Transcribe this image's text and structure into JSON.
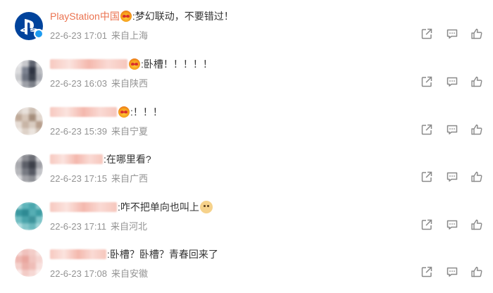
{
  "comments": [
    {
      "user": "PlayStation中国",
      "text": ":梦幻联动，不要错过！",
      "date": "22-6-23 17:01",
      "location": "来自上海",
      "verified": true
    },
    {
      "user": "",
      "text": ":卧槽！！！！！",
      "date": "22-6-23 16:03",
      "location": "来自陕西"
    },
    {
      "user": "",
      "text": ":！！！",
      "date": "22-6-23 15:39",
      "location": "来自宁夏"
    },
    {
      "user": "",
      "text": ":在哪里看?",
      "date": "22-6-23 17:15",
      "location": "来自广西"
    },
    {
      "user": "",
      "text": ":咋不把单向也叫上",
      "date": "22-6-23 17:11",
      "location": "来自河北"
    },
    {
      "user": "",
      "text": ":卧槽？卧槽？青春回来了",
      "date": "22-6-23 17:08",
      "location": "来自安徽"
    }
  ],
  "icons": {
    "forward": "forward-icon",
    "comment": "comment-icon",
    "like": "like-icon",
    "emoji_fire": "fire-face-emoji-icon",
    "emoji_doge": "doge-emoji-icon",
    "verified": "verified-badge-icon"
  },
  "colors": {
    "username": "#eb7350",
    "meta": "#939393",
    "text": "#333333",
    "ps_blue": "#00439c",
    "verified": "#1d9bf0"
  }
}
